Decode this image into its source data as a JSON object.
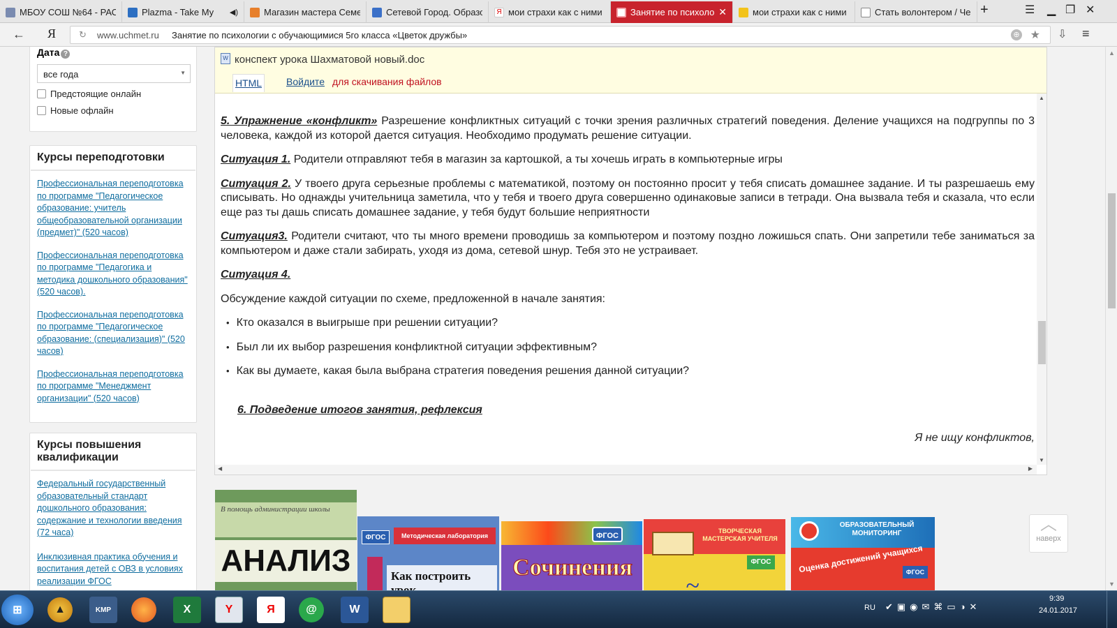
{
  "browser": {
    "tabs": [
      {
        "label": "МБОУ СОШ №64 - РАС",
        "active": false
      },
      {
        "label": "Plazma - Take My",
        "active": false
      },
      {
        "label": "Магазин мастера Семе",
        "active": false
      },
      {
        "label": "Сетевой Город. Образо",
        "active": false
      },
      {
        "label": "мои страхи как с ними",
        "active": false
      },
      {
        "label": "Занятие по психолог",
        "active": true
      },
      {
        "label": "мои страхи как с ними",
        "active": false
      },
      {
        "label": "Стать волонтером / Чем",
        "active": false
      }
    ],
    "new_tab": "+",
    "back": "←",
    "yandex_logo": "Я",
    "url_host": "www.uchmet.ru",
    "page_title": "Занятие по психологии с обучающимися 5го класса «Цветок дружбы»",
    "accent": "#c8232d"
  },
  "sidebar": {
    "date_label": "Дата",
    "date_help": "?",
    "date_select": "все года",
    "checkbox_upcoming": "Предстоящие онлайн",
    "checkbox_new": "Новые офлайн",
    "retraining": {
      "heading": "Курсы переподготовки",
      "links": [
        "Профессиональная переподготовка по программе \"Педагогическое образование: учитель общеобразовательной организации (предмет)\" (520 часов)",
        "Профессиональная переподготовка по программе \"Педагогика и методика дошкольного образования\" (520 часов).",
        "Профессиональная переподготовка по программе \"Педагогическое образование: (специализация)\" (520 часов)",
        "Профессиональная переподготовка по программе \"Менеджмент организации\" (520 часов)"
      ]
    },
    "qualification": {
      "heading": "Курсы повышения квалификации",
      "links": [
        "Федеральный государственный образовательный стандарт дошкольного образования: содержание и технологии введения (72 часа)",
        "Инклюзивная практика обучения и воспитания детей с ОВЗ в условиях реализации ФГОС"
      ]
    }
  },
  "file": {
    "name": "конспект урока Шахматовой новый.doc",
    "tab_html": "HTML",
    "login_link": "Войдите",
    "download_text": "для скачивания файлов"
  },
  "document": {
    "ex5_title": "5. Упражнение «конфликт»",
    "ex5_text": " Разрешение конфликтных ситуаций с точки зрения различных стратегий поведения. Деление учащихся на подгруппы по 3 человека, каждой из которой дается ситуация. Необходимо продумать решение ситуации.",
    "s1_title": "Ситуация 1.",
    "s1_text": " Родители отправляют тебя в магазин за картошкой, а ты хочешь играть в компьютерные игры",
    "s2_title": "Ситуация 2.",
    "s2_text": " У твоего друга серьезные проблемы с математикой, поэтому он постоянно просит у тебя списать домашнее задание. И ты разрешаешь ему списывать. Но однажды учительница заметила, что у тебя и твоего друга совершенно одинаковые записи в тетради. Она вызвала тебя и сказала, что если еще раз ты дашь списать домашнее задание, у тебя будут большие неприятности",
    "s3_title": "Ситуация3.",
    "s3_text": " Родители считают, что ты много времени проводишь за компьютером и поэтому поздно ложишься спать. Они запретили тебе заниматься за компьютером и даже стали забирать, уходя из дома, сетевой шнур. Тебя это не устраивает.",
    "s4_title": "Ситуация 4.",
    "discussion": "Обсуждение каждой ситуации по схеме, предложенной в начале занятия:",
    "questions": [
      "Кто оказался в выигрыше при решении ситуации?",
      "Был ли их выбор разрешения конфликтной ситуации эффективным?",
      "Как вы думаете, какая была выбрана стратегия поведения решения данной ситуации?"
    ],
    "sec6_title": "6. Подведение итогов занятия, рефлексия",
    "closing": "Я не ищу конфликтов,"
  },
  "books": [
    {
      "top": "В помощь администрации школы",
      "main": "АНАЛИЗ"
    },
    {
      "badge": "ФГОС",
      "series": "Методическая лаборатория",
      "main": "Как построить урок"
    },
    {
      "badge": "ФГОС",
      "main": "Сочинения"
    },
    {
      "series": "ТВОРЧЕСКАЯ МАСТЕРСКАЯ УЧИТЕЛЯ",
      "badge": "ФГОС"
    },
    {
      "series": "ОБРАЗОВАТЕЛЬНЫЙ МОНИТОРИНГ",
      "main": "Оценка достижений учащихся",
      "badge": "ФГОС"
    }
  ],
  "to_top": "наверх",
  "taskbar": {
    "lang": "RU",
    "time": "9:39",
    "date": "24.01.2017"
  }
}
